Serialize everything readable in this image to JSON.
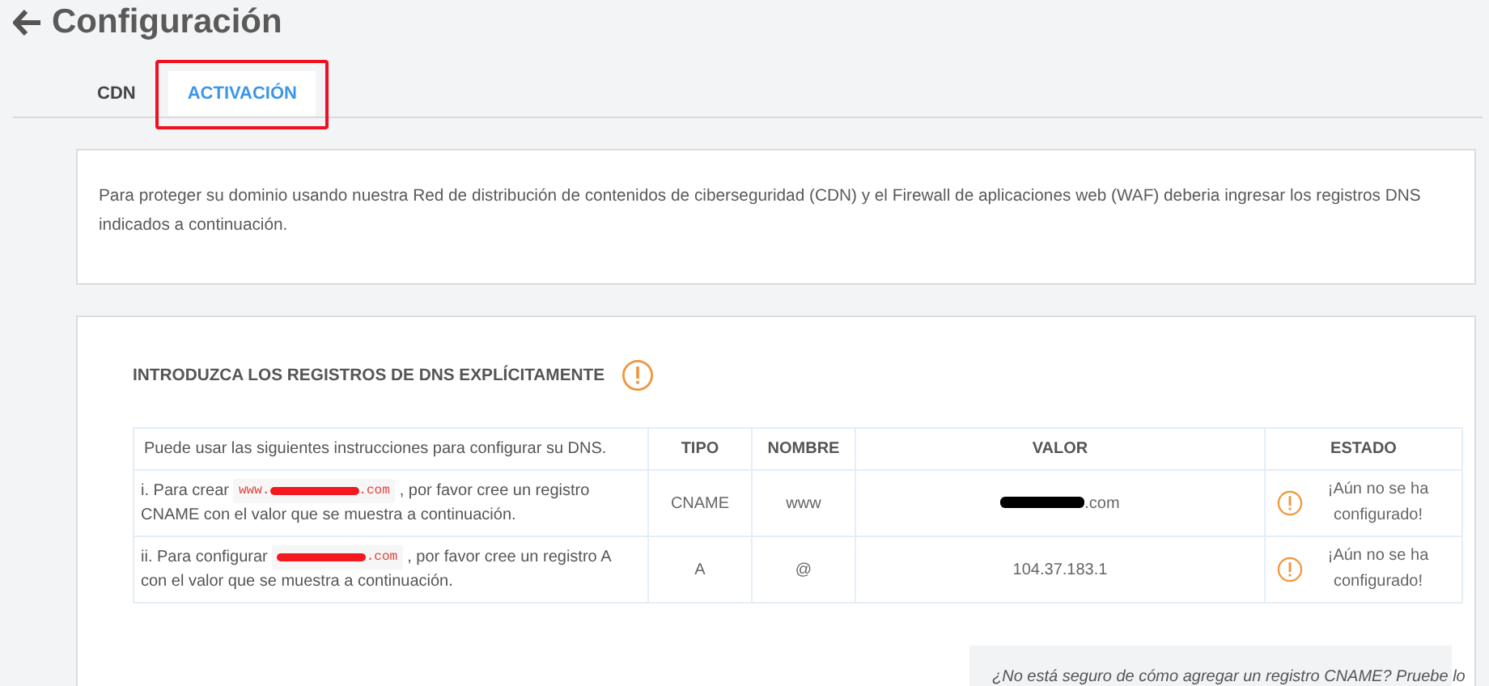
{
  "page": {
    "title": "Configuración"
  },
  "tabs": [
    {
      "label": "CDN",
      "selected": false
    },
    {
      "label": "ACTIVACIÓN",
      "selected": true,
      "highlighted": true
    }
  ],
  "intro": {
    "text": "Para proteger su dominio usando nuestra Red de distribución de contenidos de ciberseguridad (CDN) y el Firewall de aplicaciones web (WAF) deberia ingresar los registros DNS indicados a continuación."
  },
  "dns_section": {
    "heading": "INTRODUZCA LOS REGISTROS DE DNS EXPLÍCITAMENTE",
    "table": {
      "columns": [
        "Puede usar las siguientes instrucciones para configurar su DNS.",
        "TIPO",
        "NOMBRE",
        "VALOR",
        "ESTADO"
      ],
      "rows": [
        {
          "before": "i. Para crear",
          "code_prefix": "www.",
          "code_suffix": ".com",
          "after": ", por favor cree un registro CNAME con el valor que se muestra a continuación.",
          "tipo": "CNAME",
          "nombre": "www",
          "valor_redacted": true,
          "valor": ".com",
          "estado": "¡Aún no se ha configurado!",
          "configured": false
        },
        {
          "before": "ii. Para configurar",
          "code_prefix": "",
          "code_suffix": ".com",
          "after": ", por favor cree un registro A con el valor que se muestra a continuación.",
          "tipo": "A",
          "nombre": "@",
          "valor_redacted": false,
          "valor": "104.37.183.1",
          "estado": "¡Aún no se ha configurado!",
          "configured": false
        }
      ]
    }
  },
  "help_box": {
    "text": "¿No está seguro de cómo agregar un registro CNAME? Pruebe lo"
  }
}
